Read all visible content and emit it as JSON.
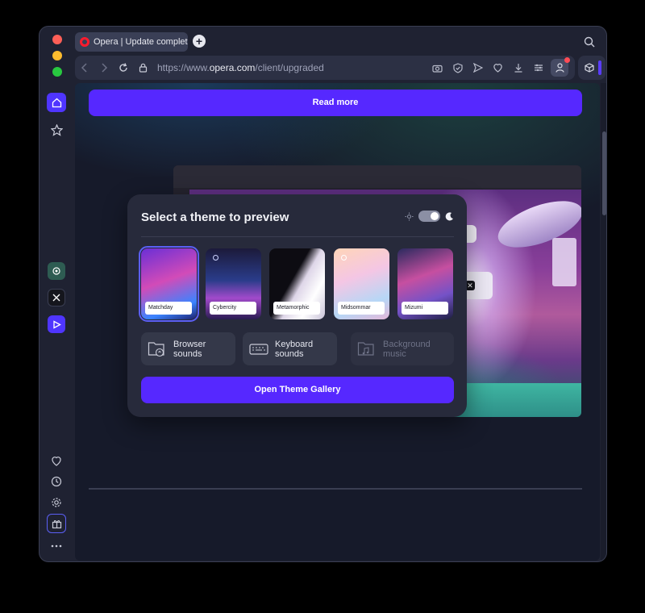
{
  "tab": {
    "title": "Opera | Update complete"
  },
  "address": {
    "prefix": "https://www.",
    "domain": "opera.com",
    "path": "/client/upgraded"
  },
  "content": {
    "read_more": "Read more",
    "panel": {
      "title": "Select a theme to preview",
      "themes": [
        {
          "label": "Matchday"
        },
        {
          "label": "Cybercity"
        },
        {
          "label": "Metamorphic"
        },
        {
          "label": "Midsommar"
        },
        {
          "label": "Mizumi"
        }
      ],
      "sounds": [
        {
          "line1": "Browser",
          "line2": "sounds"
        },
        {
          "line1": "Keyboard",
          "line2": "sounds"
        },
        {
          "line1": "Background",
          "line2": "music"
        }
      ],
      "gallery_button": "Open Theme Gallery"
    }
  },
  "colors": {
    "accent": "#5628ff",
    "tab_opera_logo": "#ff1b2d",
    "home_active": "#4f35ff"
  }
}
